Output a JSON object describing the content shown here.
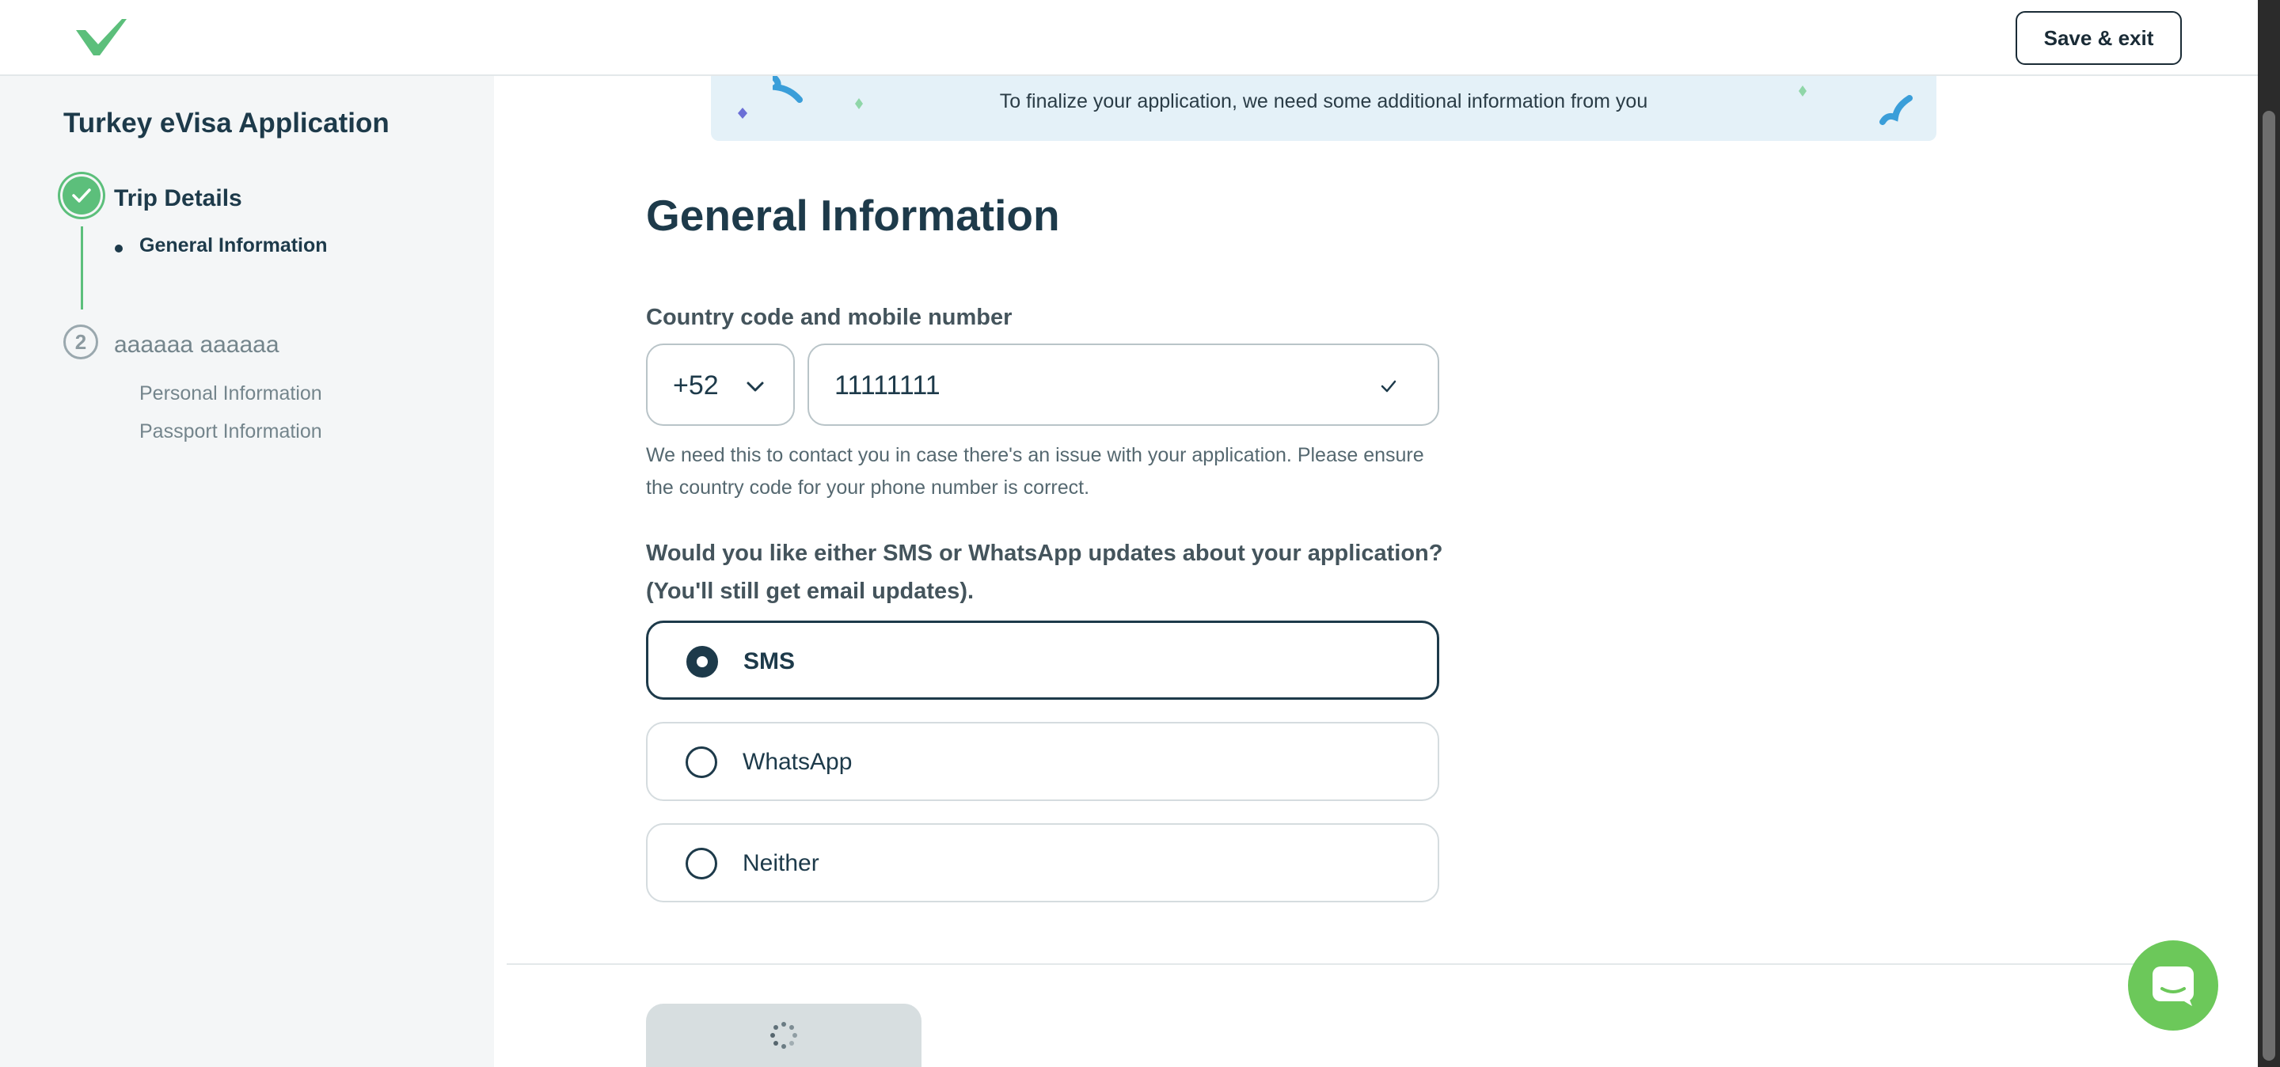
{
  "header": {
    "logo_icon": "checkmark-logo-icon",
    "save_exit_label": "Save & exit"
  },
  "sidebar": {
    "app_title": "Turkey eVisa Application",
    "steps": [
      {
        "status": "complete",
        "label": "Trip Details",
        "subitems": [
          "General Information"
        ]
      },
      {
        "number": "2",
        "label": "aaaaaa aaaaaa",
        "subitems": [
          "Personal Information",
          "Passport Information"
        ]
      }
    ]
  },
  "banner": {
    "text": "To finalize your application, we need some additional information from you"
  },
  "main": {
    "title": "General Information",
    "phone": {
      "label": "Country code and mobile number",
      "country_code": "+52",
      "number": "11111111",
      "helper": "We need this to contact you in case there's an issue with your application. Please ensure the country code for your phone number is correct."
    },
    "updates": {
      "question": "Would you like either SMS or WhatsApp updates about your application? (You'll still get email updates).",
      "options": [
        {
          "label": "SMS",
          "selected": true
        },
        {
          "label": "WhatsApp",
          "selected": false
        },
        {
          "label": "Neither",
          "selected": false
        }
      ]
    },
    "continue_state": "loading"
  },
  "colors": {
    "primary_text": "#1d3a4a",
    "accent_green": "#5cbf7b",
    "chat_green": "#6cc85a",
    "banner_bg": "#e4f1f8"
  }
}
